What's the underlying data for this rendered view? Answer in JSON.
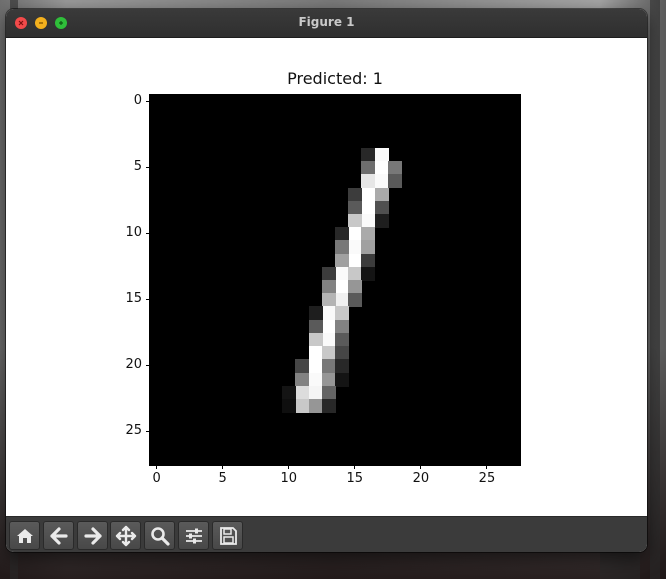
{
  "window": {
    "title": "Figure 1",
    "controls": [
      "close",
      "minimize",
      "maximize"
    ]
  },
  "figure": {
    "title": "Predicted: 1",
    "x_ticks": [
      "0",
      "5",
      "10",
      "15",
      "20",
      "25"
    ],
    "y_ticks": [
      "0",
      "5",
      "10",
      "15",
      "20",
      "25"
    ]
  },
  "toolbar": {
    "buttons": [
      {
        "name": "home",
        "icon": "home-icon"
      },
      {
        "name": "back",
        "icon": "arrow-left-icon"
      },
      {
        "name": "forward",
        "icon": "arrow-right-icon"
      },
      {
        "name": "pan",
        "icon": "move-icon"
      },
      {
        "name": "zoom",
        "icon": "magnifier-icon"
      },
      {
        "name": "configure-subplots",
        "icon": "sliders-icon"
      },
      {
        "name": "save",
        "icon": "floppy-disk-icon"
      }
    ]
  },
  "colors": {
    "titlebar": "#333333",
    "toolbar": "#3b3b3b",
    "close": "#f24a4a",
    "minimize": "#f3b01d",
    "maximize": "#2fbf3a"
  },
  "chart_data": {
    "type": "heatmap",
    "title": "Predicted: 1",
    "colormap": "gray",
    "shape": [
      28,
      28
    ],
    "xlim": [
      -0.5,
      27.5
    ],
    "ylim": [
      27.5,
      -0.5
    ],
    "pixels": [
      {
        "x": 17,
        "y": 4,
        "v": 250
      },
      {
        "x": 16,
        "y": 4,
        "v": 40
      },
      {
        "x": 17,
        "y": 5,
        "v": 255
      },
      {
        "x": 16,
        "y": 5,
        "v": 110
      },
      {
        "x": 18,
        "y": 5,
        "v": 120
      },
      {
        "x": 16,
        "y": 6,
        "v": 230
      },
      {
        "x": 17,
        "y": 6,
        "v": 250
      },
      {
        "x": 18,
        "y": 6,
        "v": 90
      },
      {
        "x": 16,
        "y": 7,
        "v": 255
      },
      {
        "x": 17,
        "y": 7,
        "v": 170
      },
      {
        "x": 15,
        "y": 7,
        "v": 60
      },
      {
        "x": 16,
        "y": 8,
        "v": 255
      },
      {
        "x": 15,
        "y": 8,
        "v": 90
      },
      {
        "x": 17,
        "y": 8,
        "v": 80
      },
      {
        "x": 16,
        "y": 9,
        "v": 250
      },
      {
        "x": 15,
        "y": 9,
        "v": 200
      },
      {
        "x": 17,
        "y": 9,
        "v": 30
      },
      {
        "x": 15,
        "y": 10,
        "v": 255
      },
      {
        "x": 16,
        "y": 10,
        "v": 170
      },
      {
        "x": 14,
        "y": 10,
        "v": 40
      },
      {
        "x": 15,
        "y": 11,
        "v": 250
      },
      {
        "x": 14,
        "y": 11,
        "v": 120
      },
      {
        "x": 16,
        "y": 11,
        "v": 160
      },
      {
        "x": 15,
        "y": 12,
        "v": 255
      },
      {
        "x": 14,
        "y": 12,
        "v": 160
      },
      {
        "x": 16,
        "y": 12,
        "v": 60
      },
      {
        "x": 14,
        "y": 13,
        "v": 250
      },
      {
        "x": 15,
        "y": 13,
        "v": 200
      },
      {
        "x": 13,
        "y": 13,
        "v": 60
      },
      {
        "x": 16,
        "y": 13,
        "v": 20
      },
      {
        "x": 14,
        "y": 14,
        "v": 255
      },
      {
        "x": 13,
        "y": 14,
        "v": 130
      },
      {
        "x": 15,
        "y": 14,
        "v": 150
      },
      {
        "x": 14,
        "y": 15,
        "v": 240
      },
      {
        "x": 13,
        "y": 15,
        "v": 180
      },
      {
        "x": 15,
        "y": 15,
        "v": 90
      },
      {
        "x": 13,
        "y": 16,
        "v": 250
      },
      {
        "x": 14,
        "y": 16,
        "v": 200
      },
      {
        "x": 12,
        "y": 16,
        "v": 30
      },
      {
        "x": 13,
        "y": 17,
        "v": 255
      },
      {
        "x": 12,
        "y": 17,
        "v": 90
      },
      {
        "x": 14,
        "y": 17,
        "v": 130
      },
      {
        "x": 13,
        "y": 18,
        "v": 250
      },
      {
        "x": 12,
        "y": 18,
        "v": 200
      },
      {
        "x": 14,
        "y": 18,
        "v": 90
      },
      {
        "x": 12,
        "y": 19,
        "v": 255
      },
      {
        "x": 13,
        "y": 19,
        "v": 200
      },
      {
        "x": 14,
        "y": 19,
        "v": 70
      },
      {
        "x": 12,
        "y": 20,
        "v": 255
      },
      {
        "x": 11,
        "y": 20,
        "v": 70
      },
      {
        "x": 13,
        "y": 20,
        "v": 120
      },
      {
        "x": 14,
        "y": 20,
        "v": 40
      },
      {
        "x": 12,
        "y": 21,
        "v": 250
      },
      {
        "x": 11,
        "y": 21,
        "v": 130
      },
      {
        "x": 13,
        "y": 21,
        "v": 150
      },
      {
        "x": 14,
        "y": 21,
        "v": 20
      },
      {
        "x": 11,
        "y": 22,
        "v": 220
      },
      {
        "x": 12,
        "y": 22,
        "v": 245
      },
      {
        "x": 13,
        "y": 22,
        "v": 100
      },
      {
        "x": 10,
        "y": 22,
        "v": 20
      },
      {
        "x": 11,
        "y": 23,
        "v": 200
      },
      {
        "x": 12,
        "y": 23,
        "v": 150
      },
      {
        "x": 13,
        "y": 23,
        "v": 40
      },
      {
        "x": 10,
        "y": 23,
        "v": 15
      }
    ]
  }
}
